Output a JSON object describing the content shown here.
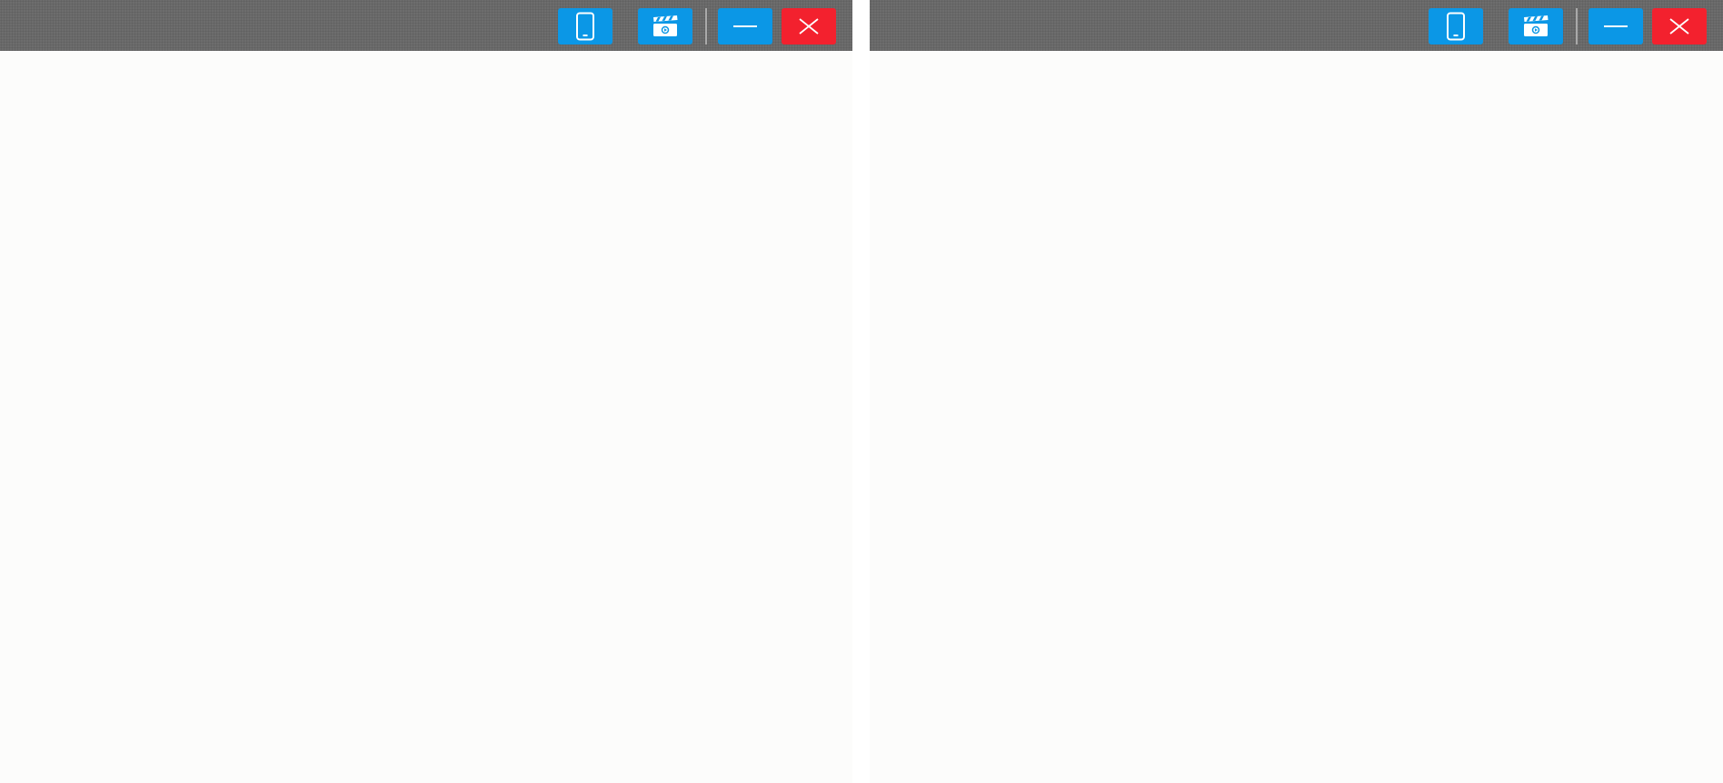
{
  "colors": {
    "titlebar": "#6d6d6d",
    "primary_button": "#0b97e6",
    "close_button": "#f3212e",
    "content_background": "#fcfcfb",
    "divider": "#a9a9a9"
  },
  "windows": [
    {
      "id": "left",
      "buttons": [
        {
          "name": "phone-button",
          "icon": "phone-icon"
        },
        {
          "name": "video-button",
          "icon": "clapperboard-icon"
        },
        {
          "name": "minimize-button",
          "icon": "minimize-icon"
        },
        {
          "name": "close-button",
          "icon": "close-icon"
        }
      ]
    },
    {
      "id": "right",
      "buttons": [
        {
          "name": "phone-button",
          "icon": "phone-icon"
        },
        {
          "name": "video-button",
          "icon": "clapperboard-icon"
        },
        {
          "name": "minimize-button",
          "icon": "minimize-icon"
        },
        {
          "name": "close-button",
          "icon": "close-icon"
        }
      ]
    }
  ]
}
